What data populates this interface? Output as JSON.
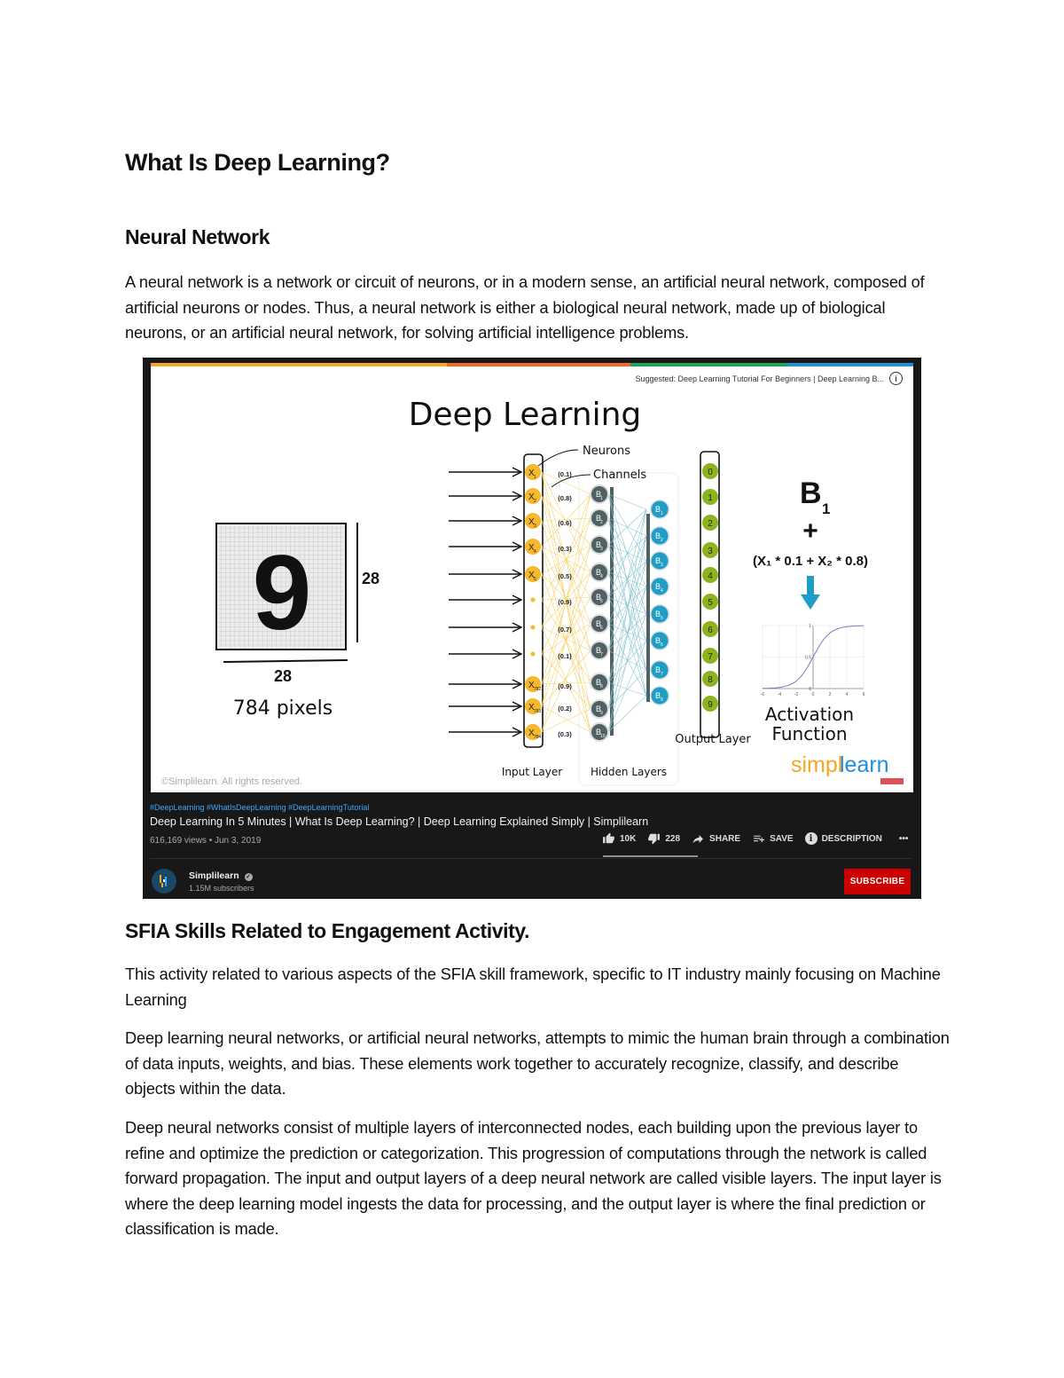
{
  "document": {
    "title": "What Is Deep Learning?",
    "section1_heading": "Neural Network",
    "section1_paragraph": "A neural network is a network or circuit of neurons, or in a modern sense, an artificial neural network, composed of artificial neurons or nodes. Thus, a neural network is either a biological neural network, made up of biological neurons, or an artificial neural network, for solving artificial intelligence problems.",
    "section2_heading": "SFIA Skills Related to Engagement Activity.",
    "section2_paragraphs": [
      "This activity related to various aspects of the SFIA skill framework, specific to IT industry mainly focusing on Machine Learning",
      "Deep learning neural networks, or artificial neural networks, attempts to mimic the human brain through a combination of data inputs, weights, and bias. These elements work together to accurately recognize, classify, and describe objects within the data.",
      "Deep neural networks consist of multiple layers of interconnected nodes, each building upon the previous layer to refine and optimize the prediction or categorization. This progression of computations through the network is called forward propagation. The input and output layers of a deep neural network are called visible layers. The input layer is where the deep learning model ingests the data for processing, and the output layer is where the final prediction or classification is made."
    ]
  },
  "video": {
    "suggested": "Suggested: Deep Learning Tutorial For Beginners | Deep Learning B...",
    "info_icon": "i",
    "colors": {
      "bar1": "#f5a623",
      "bar2": "#f26a2a",
      "bar3": "#1aa15a",
      "bar4": "#1f8fd6",
      "subscribe": "#cc0000",
      "input_node": "#f7b82b",
      "hidden1_node": "#4f6163",
      "hidden2_node": "#1e9ec6",
      "output_node": "#8db41f"
    },
    "frame": {
      "heading": "Deep Learning",
      "digit": "9",
      "dim_height": "28",
      "dim_width": "28",
      "pixels_label": "784 pixels",
      "neurons_label": "Neurons",
      "channels_label": "Channels",
      "input_nodes": [
        "X1",
        "X2",
        "X3",
        "X4",
        "X5",
        "•",
        "•",
        "•",
        "X782",
        "X783",
        "X784"
      ],
      "weights": [
        "(0.1)",
        "(0.8)",
        "(0.6)",
        "(0.3)",
        "(0.5)",
        "(0.9)",
        "(0.7)",
        "(0.1)",
        "(0.9)",
        "(0.2)",
        "(0.3)"
      ],
      "hidden1_nodes": [
        "B1",
        "B2",
        "B3",
        "B4",
        "B5",
        "B6",
        "B7",
        "B8",
        "B9",
        "B10"
      ],
      "hidden2_nodes": [
        "B1",
        "B2",
        "B3",
        "B4",
        "B5",
        "B6",
        "B7",
        "B8"
      ],
      "output_nodes": [
        "0",
        "1",
        "2",
        "3",
        "4",
        "5",
        "6",
        "7",
        "8",
        "9"
      ],
      "input_layer_label": "Input Layer",
      "hidden_layers_label": "Hidden Layers",
      "output_layer_label": "Output Layer",
      "formula_bias": "B",
      "formula_bias_sub": "1",
      "formula_plus": "+",
      "formula_expr": "(X₁ * 0.1  + X₂ * 0.8)",
      "activation_label_1": "Activation",
      "activation_label_2": "Function",
      "sigmoid_x_ticks": [
        "-6",
        "-4",
        "-2",
        "0",
        "2",
        "4",
        "6"
      ],
      "sigmoid_y_ticks": [
        "0",
        "0.5",
        "1"
      ],
      "brand_1": "simpl",
      "brand_2": "learn",
      "copyright": "©Simplilearn. All rights reserved."
    },
    "tags": "#DeepLearning #WhatIsDeepLearning #DeepLearningTutorial",
    "title": "Deep Learning In 5 Minutes | What Is Deep Learning? | Deep Learning Explained Simply | Simplilearn",
    "views_date": "616,169 views • Jun 3, 2019",
    "likes": "10K",
    "dislikes": "228",
    "share_label": "SHARE",
    "save_label": "SAVE",
    "description_label": "DESCRIPTION",
    "more_label": "•••",
    "channel_name": "Simplilearn",
    "subscribers": "1.15M subscribers",
    "subscribe_label": "SUBSCRIBE"
  }
}
